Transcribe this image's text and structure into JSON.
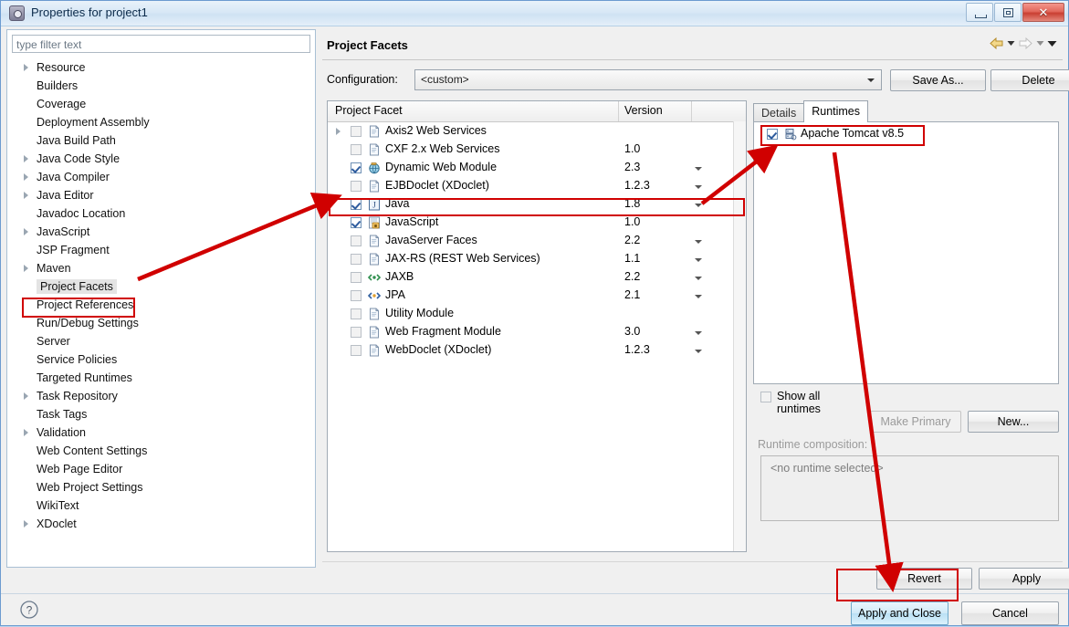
{
  "window": {
    "title": "Properties for project1",
    "icon": "properties-icon",
    "controls": {
      "minimize": "minimize-icon",
      "maximize": "maximize-icon",
      "close": "✕"
    }
  },
  "sidebar": {
    "filter_placeholder": "type filter text",
    "filter_value": "",
    "selected": "Project Facets",
    "items": [
      {
        "label": "Resource",
        "expandable": true
      },
      {
        "label": "Builders",
        "expandable": false
      },
      {
        "label": "Coverage",
        "expandable": false
      },
      {
        "label": "Deployment Assembly",
        "expandable": false
      },
      {
        "label": "Java Build Path",
        "expandable": false
      },
      {
        "label": "Java Code Style",
        "expandable": true
      },
      {
        "label": "Java Compiler",
        "expandable": true
      },
      {
        "label": "Java Editor",
        "expandable": true
      },
      {
        "label": "Javadoc Location",
        "expandable": false
      },
      {
        "label": "JavaScript",
        "expandable": true
      },
      {
        "label": "JSP Fragment",
        "expandable": false
      },
      {
        "label": "Maven",
        "expandable": true
      },
      {
        "label": "Project Facets",
        "expandable": false
      },
      {
        "label": "Project References",
        "expandable": false
      },
      {
        "label": "Run/Debug Settings",
        "expandable": false
      },
      {
        "label": "Server",
        "expandable": false
      },
      {
        "label": "Service Policies",
        "expandable": false
      },
      {
        "label": "Targeted Runtimes",
        "expandable": false
      },
      {
        "label": "Task Repository",
        "expandable": true
      },
      {
        "label": "Task Tags",
        "expandable": false
      },
      {
        "label": "Validation",
        "expandable": true
      },
      {
        "label": "Web Content Settings",
        "expandable": false
      },
      {
        "label": "Web Page Editor",
        "expandable": false
      },
      {
        "label": "Web Project Settings",
        "expandable": false
      },
      {
        "label": "WikiText",
        "expandable": false
      },
      {
        "label": "XDoclet",
        "expandable": true
      }
    ]
  },
  "page": {
    "title": "Project Facets",
    "nav": {
      "back_icon": "back-arrow-icon",
      "back_menu_icon": "chevron-down-icon",
      "forward_icon": "forward-arrow-icon",
      "forward_menu_icon": "chevron-down-icon",
      "menu_icon": "chevron-down-icon"
    },
    "configuration": {
      "label": "Configuration:",
      "value": "<custom>",
      "save_as_label": "Save As...",
      "delete_label": "Delete"
    }
  },
  "facets": {
    "columns": {
      "name": "Project Facet",
      "version": "Version"
    },
    "rows": [
      {
        "name": "Axis2 Web Services",
        "version": "",
        "checked": false,
        "expandable": true,
        "caret": false,
        "icon": "document-icon"
      },
      {
        "name": "CXF 2.x Web Services",
        "version": "1.0",
        "checked": false,
        "expandable": false,
        "caret": false,
        "icon": "document-icon"
      },
      {
        "name": "Dynamic Web Module",
        "version": "2.3",
        "checked": true,
        "expandable": false,
        "caret": true,
        "icon": "globe-icon"
      },
      {
        "name": "EJBDoclet (XDoclet)",
        "version": "1.2.3",
        "checked": false,
        "expandable": false,
        "caret": true,
        "icon": "document-icon"
      },
      {
        "name": "Java",
        "version": "1.8",
        "checked": true,
        "expandable": false,
        "caret": true,
        "icon": "java-icon"
      },
      {
        "name": "JavaScript",
        "version": "1.0",
        "checked": true,
        "expandable": false,
        "caret": false,
        "icon": "javascript-icon"
      },
      {
        "name": "JavaServer Faces",
        "version": "2.2",
        "checked": false,
        "expandable": false,
        "caret": true,
        "icon": "document-icon"
      },
      {
        "name": "JAX-RS (REST Web Services)",
        "version": "1.1",
        "checked": false,
        "expandable": false,
        "caret": true,
        "icon": "document-icon"
      },
      {
        "name": "JAXB",
        "version": "2.2",
        "checked": false,
        "expandable": false,
        "caret": true,
        "icon": "jaxb-icon"
      },
      {
        "name": "JPA",
        "version": "2.1",
        "checked": false,
        "expandable": false,
        "caret": true,
        "icon": "jpa-icon"
      },
      {
        "name": "Utility Module",
        "version": "",
        "checked": false,
        "expandable": false,
        "caret": false,
        "icon": "document-icon"
      },
      {
        "name": "Web Fragment Module",
        "version": "3.0",
        "checked": false,
        "expandable": false,
        "caret": true,
        "icon": "document-icon"
      },
      {
        "name": "WebDoclet (XDoclet)",
        "version": "1.2.3",
        "checked": false,
        "expandable": false,
        "caret": true,
        "icon": "document-icon"
      }
    ]
  },
  "runtimes": {
    "tabs": [
      {
        "label": "Details",
        "active": false
      },
      {
        "label": "Runtimes",
        "active": true
      }
    ],
    "items": [
      {
        "label": "Apache Tomcat v8.5",
        "checked": true,
        "icon": "server-icon"
      }
    ],
    "show_all_label": "Show all runtimes",
    "show_all_checked": false,
    "make_primary_label": "Make Primary",
    "make_primary_disabled": true,
    "new_label": "New...",
    "composition_label": "Runtime composition:",
    "composition_value": "<no runtime selected>"
  },
  "footer": {
    "revert_label": "Revert",
    "apply_label": "Apply",
    "apply_close_label": "Apply and Close",
    "cancel_label": "Cancel",
    "help_icon": "help-icon"
  },
  "annotations": {
    "color": "#d00000",
    "highlight_boxes": [
      "Project Facets",
      "Java",
      "Apache Tomcat v8.5",
      "Apply and Close"
    ]
  }
}
